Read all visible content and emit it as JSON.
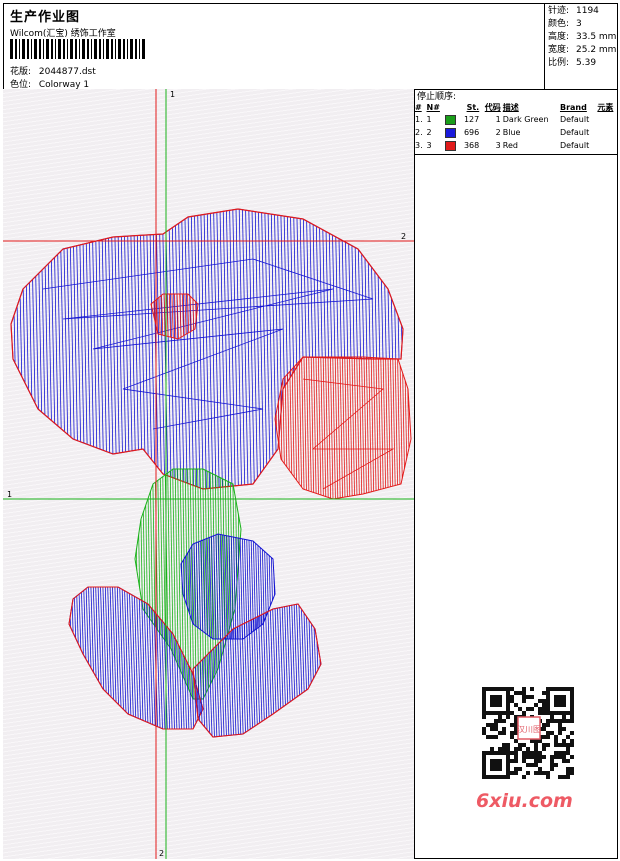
{
  "header": {
    "title": "生产作业图",
    "studio": "Wilcom(汇宝) 绣饰工作室",
    "design_label": "花版:",
    "design_value": "2044877.dst",
    "colorway_label": "色位:",
    "colorway_value": "Colorway 1"
  },
  "stats": [
    {
      "label": "针迹:",
      "value": "1194"
    },
    {
      "label": "颜色:",
      "value": "3"
    },
    {
      "label": "高度:",
      "value": "33.5 mm"
    },
    {
      "label": "宽度:",
      "value": "25.2 mm"
    },
    {
      "label": "比例:",
      "value": "5.39"
    }
  ],
  "thread_panel": {
    "sort_label": "停止顺序:",
    "columns": [
      "#",
      "N#",
      "St.",
      "代码",
      "描述",
      "Brand",
      "元素"
    ],
    "rows": [
      {
        "index": "1.",
        "n": "1",
        "color": "#1a9e1a",
        "stitches": "127",
        "code": "1",
        "description": "Dark Green",
        "brand": "Default"
      },
      {
        "index": "2.",
        "n": "2",
        "color": "#1a1adc",
        "stitches": "696",
        "code": "2",
        "description": "Blue",
        "brand": "Default"
      },
      {
        "index": "3.",
        "n": "3",
        "color": "#e01a1a",
        "stitches": "368",
        "code": "3",
        "description": "Red",
        "brand": "Default"
      }
    ]
  },
  "guides": {
    "v_green_label": "1",
    "v_red_label": "2",
    "h_green_label": "1",
    "h_red_label": "2"
  },
  "colors": {
    "green": "#19b219",
    "blue": "#1414d2",
    "red": "#e31a1a"
  },
  "watermark": "6xiu.com",
  "qr_stamp_text": "汉川图"
}
